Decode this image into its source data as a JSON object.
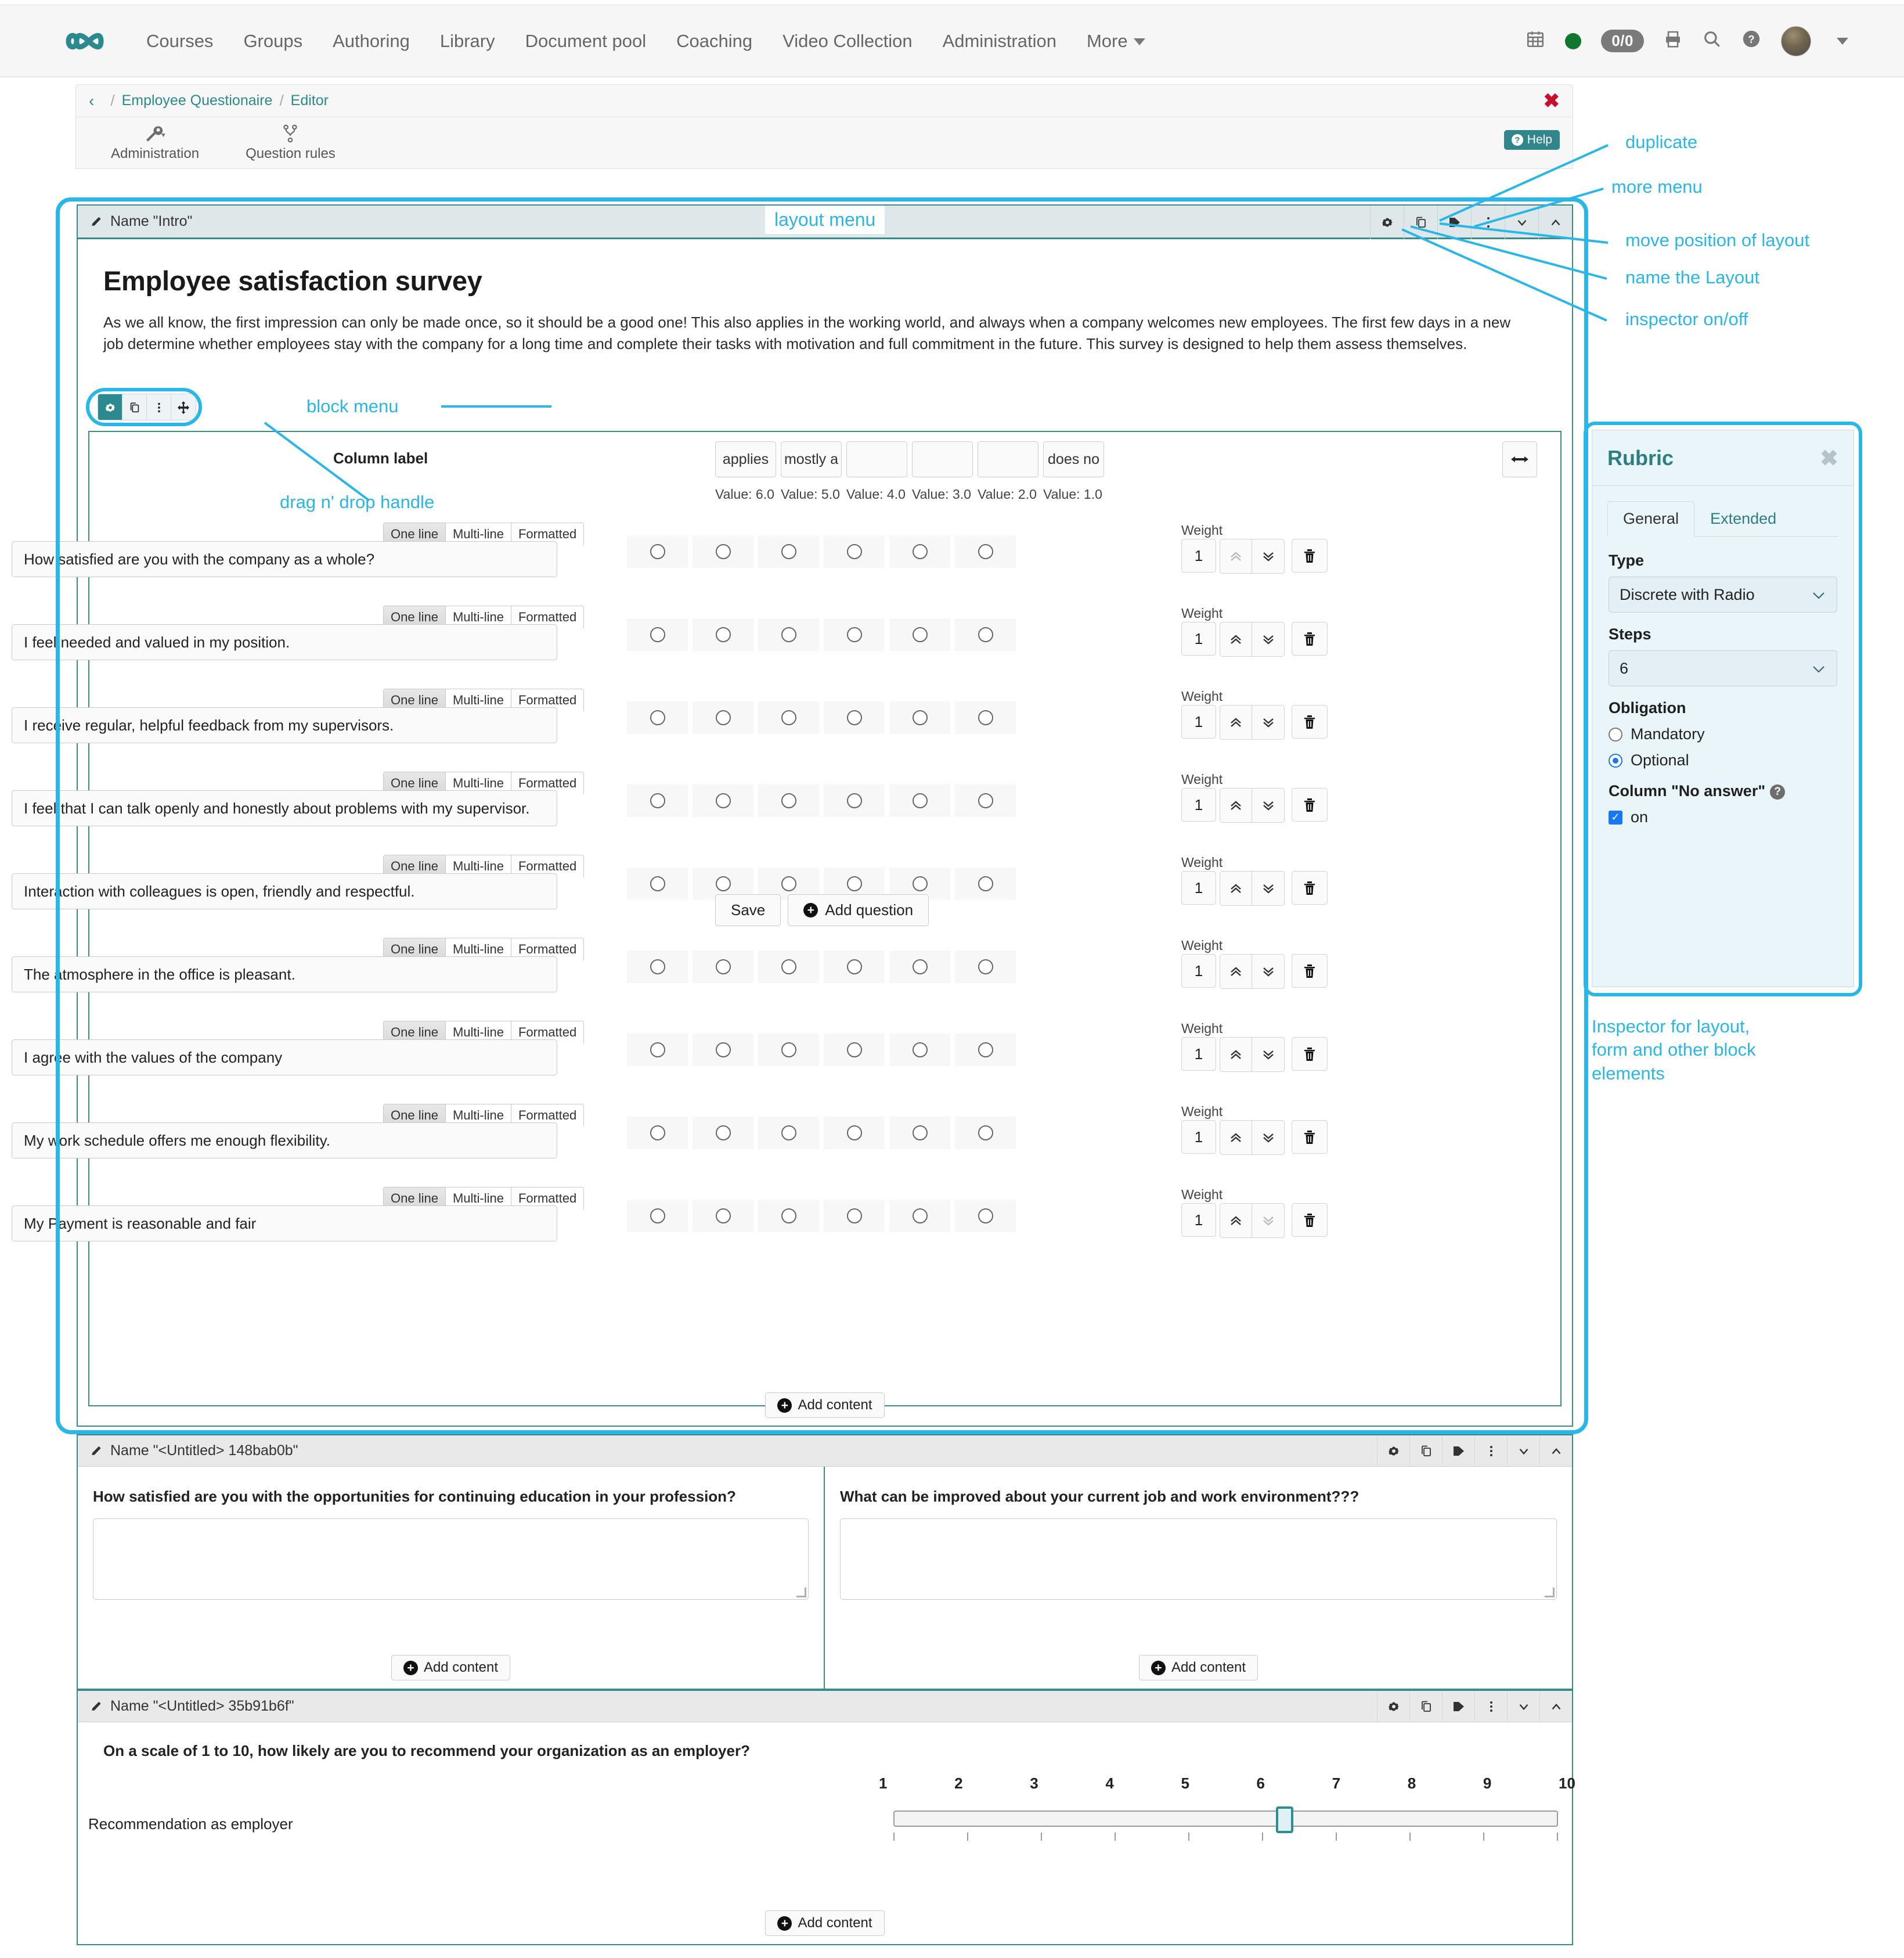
{
  "topnav": {
    "logo": "infinity-logo",
    "links": [
      "Courses",
      "Groups",
      "Authoring",
      "Library",
      "Document pool",
      "Coaching",
      "Video Collection",
      "Administration"
    ],
    "more_label": "More",
    "notification_badge": "0/0",
    "icons": [
      "calendar-icon",
      "status-dot-icon",
      "notification-badge",
      "print-icon",
      "search-icon",
      "help-icon",
      "avatar",
      "user-menu-caret"
    ]
  },
  "breadcrumb": {
    "back": "‹",
    "items": [
      "Employee Questionaire",
      "Editor"
    ],
    "separator": "/",
    "close": "✖"
  },
  "toolbar": {
    "items": [
      {
        "label": "Administration",
        "icon": "wrench-icon",
        "has_caret": true
      },
      {
        "label": "Question rules",
        "icon": "branch-icon",
        "has_caret": false
      }
    ],
    "help_label": "Help"
  },
  "layout_block": {
    "name": "Name \"Intro\"",
    "header_icons": [
      "gear-icon",
      "duplicate-icon",
      "tag-icon",
      "more-vertical-icon",
      "chevron-down-icon",
      "chevron-up-icon"
    ],
    "survey_title": "Employee satisfaction survey",
    "survey_desc": "As we all know, the first impression can only be made once, so it should be a good one! This also applies in the working world, and always when a company welcomes new employees. The first few days in a new job determine whether employees stay with the company for a long time and complete their tasks with motivation and full commitment in the future. This survey is designed to help them assess themselves.",
    "block_menu_icons": [
      "gear-icon",
      "duplicate-icon",
      "more-vertical-icon",
      "move-icon"
    ],
    "add_content_label": "Add content"
  },
  "rubric": {
    "column_label": "Column label",
    "columns": [
      {
        "text": "applies",
        "value": "Value: 6.0"
      },
      {
        "text": "mostly a",
        "value": "Value: 5.0"
      },
      {
        "text": "",
        "value": "Value: 4.0"
      },
      {
        "text": "",
        "value": "Value: 3.0"
      },
      {
        "text": "",
        "value": "Value: 2.0"
      },
      {
        "text": "does no",
        "value": "Value: 1.0"
      }
    ],
    "expand_icon": "horizontal-resize-icon",
    "tabs": [
      "One line",
      "Multi-line",
      "Formatted"
    ],
    "active_tab": "One line",
    "weight_label": "Weight",
    "questions": [
      {
        "text": "How satisfied are you with the company as a whole?",
        "weight": "1"
      },
      {
        "text": "I feel needed and valued in my position.",
        "weight": "1"
      },
      {
        "text": "I receive regular, helpful feedback from my supervisors.",
        "weight": "1"
      },
      {
        "text": "I feel that I can talk openly and honestly about problems with my supervisor.",
        "weight": "1"
      },
      {
        "text": "Interaction with colleagues is open, friendly and respectful.",
        "weight": "1"
      },
      {
        "text": "The atmosphere in the office is pleasant.",
        "weight": "1"
      },
      {
        "text": "I agree with the values of the company",
        "weight": "1"
      },
      {
        "text": "My work schedule offers me enough flexibility.",
        "weight": "1"
      },
      {
        "text": "My Payment is reasonable and fair",
        "weight": "1"
      }
    ],
    "save_label": "Save",
    "add_question_label": "Add question"
  },
  "block2": {
    "name": "Name \"<Untitled> 148bab0b\"",
    "header_icons": [
      "gear-icon",
      "duplicate-icon",
      "tag-icon",
      "more-vertical-icon",
      "chevron-down-icon",
      "chevron-up-icon"
    ],
    "left_question": "How satisfied are you with the opportunities for continuing education in your profession?",
    "right_question": "What can be improved about your current job and work environment???",
    "left_value": "",
    "right_value": "",
    "add_content_label": "Add content"
  },
  "block3": {
    "name": "Name \"<Untitled> 35b91b6f\"",
    "header_icons": [
      "gear-icon",
      "duplicate-icon",
      "tag-icon",
      "more-vertical-icon",
      "chevron-down-icon",
      "chevron-up-icon"
    ],
    "question": "On a scale of 1 to 10, how likely are you to recommend your organization as an employer?",
    "slider_label": "Recommendation as employer",
    "scale": [
      "1",
      "2",
      "3",
      "4",
      "5",
      "6",
      "7",
      "8",
      "9",
      "10"
    ],
    "slider_value": "6",
    "add_content_label": "Add content"
  },
  "inspector": {
    "title": "Rubric",
    "close": "✖",
    "tabs": [
      "General",
      "Extended"
    ],
    "active_tab": "General",
    "type_label": "Type",
    "type_value": "Discrete with Radio",
    "steps_label": "Steps",
    "steps_value": "6",
    "obligation_label": "Obligation",
    "obligation_options": [
      "Mandatory",
      "Optional"
    ],
    "obligation_selected": "Optional",
    "no_answer_label": "Column \"No answer\"",
    "no_answer_checkbox_label": "on",
    "no_answer_checked": true
  },
  "annotations": {
    "duplicate": "duplicate",
    "more_menu": "more menu",
    "move_position": "move position of layout",
    "name_layout": "name the Layout",
    "inspector_toggle": "inspector on/off",
    "layout_menu": "layout menu",
    "block_menu": "block menu",
    "drag_handle": "drag n' drop handle",
    "inspector_desc": "Inspector for layout,\nform and other block\nelements"
  },
  "colors": {
    "brand_teal": "#2b8a8f",
    "annotation_blue": "#29b6e8",
    "close_red": "#c8102e",
    "status_green": "#10772f"
  }
}
